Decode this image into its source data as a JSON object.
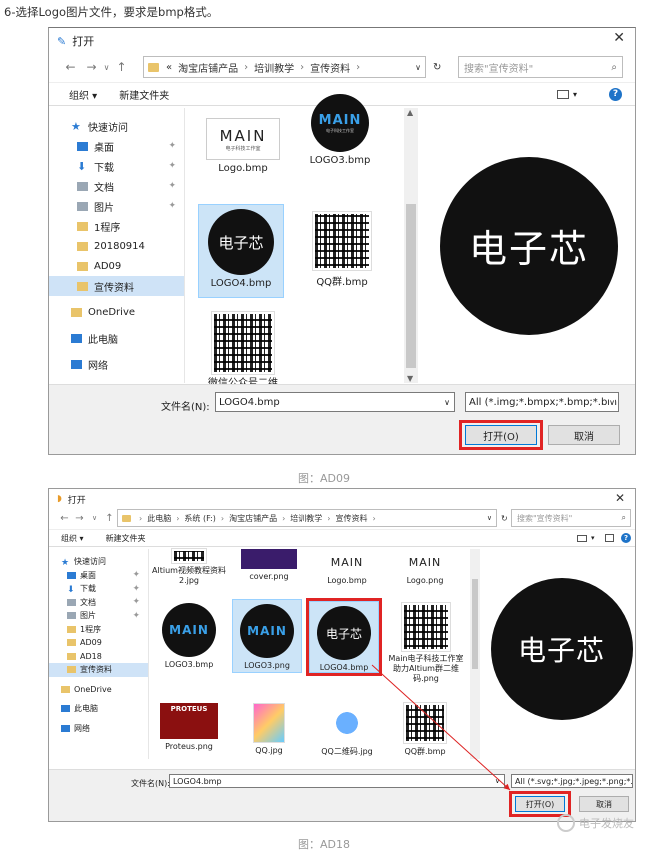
{
  "intro": "6-选择Logo图片文件，要求是bmp格式。",
  "dialog1": {
    "title": "打开",
    "path": [
      "«",
      "淘宝店铺产品",
      "培训教学",
      "宣传资料"
    ],
    "search_placeholder": "搜索\"宣传资料\"",
    "organize": "组织 ▾",
    "new_folder": "新建文件夹",
    "sidebar": {
      "quick_access": "快速访问",
      "items": [
        "桌面",
        "下载",
        "文档",
        "图片",
        "1程序",
        "20180914",
        "AD09",
        "宣传资料"
      ],
      "onedrive": "OneDrive",
      "this_pc": "此电脑",
      "network": "网络"
    },
    "files": [
      "Logo.bmp",
      "LOGO3.bmp",
      "LOGO4.bmp",
      "QQ群.bmp",
      "微信公众号二维码.bmp"
    ],
    "main_logo_text": "MAIN",
    "main_logo_sub": "电子科技工作室",
    "logo4_text": "电子芯",
    "preview_text": "电子芯",
    "filename_label": "文件名(N):",
    "filename_value": "LOGO4.bmp",
    "filter_value": "All (*.img;*.bmpx;*.bmp;*.bm",
    "open_label": "打开(O)",
    "cancel_label": "取消"
  },
  "caption1": "图：AD09",
  "dialog2": {
    "title": "打开",
    "path": [
      "此电脑",
      "系统 (F:)",
      "淘宝店铺产品",
      "培训教学",
      "宣传资料"
    ],
    "search_placeholder": "搜索\"宣传资料\"",
    "organize": "组织 ▾",
    "new_folder": "新建文件夹",
    "sidebar": {
      "quick_access": "快速访问",
      "items": [
        "桌面",
        "下载",
        "文档",
        "图片",
        "1程序",
        "AD09",
        "AD18",
        "宣传资料"
      ],
      "onedrive": "OneDrive",
      "this_pc": "此电脑",
      "network": "网络"
    },
    "files": [
      "Altium视频教程资料2.jpg",
      "cover.png",
      "Logo.bmp",
      "Logo.png",
      "LOGO3.bmp",
      "LOGO3.png",
      "LOGO4.bmp",
      "Main电子科技工作室助力Altium群二维码.png",
      "Proteus.png",
      "QQ.jpg",
      "QQ二维码.jpg",
      "QQ群.bmp"
    ],
    "main_logo_text": "MAIN",
    "logo4_text": "电子芯",
    "proteus_text": "PROTEUS",
    "preview_text": "电子芯",
    "filename_label": "文件名(N):",
    "filename_value": "LOGO4.bmp",
    "filter_value": "All (*.svg;*.jpg;*.jpeg;*.png;*.",
    "open_label": "打开(O)",
    "cancel_label": "取消"
  },
  "caption2": "图：AD18",
  "watermark": "电子发烧友"
}
